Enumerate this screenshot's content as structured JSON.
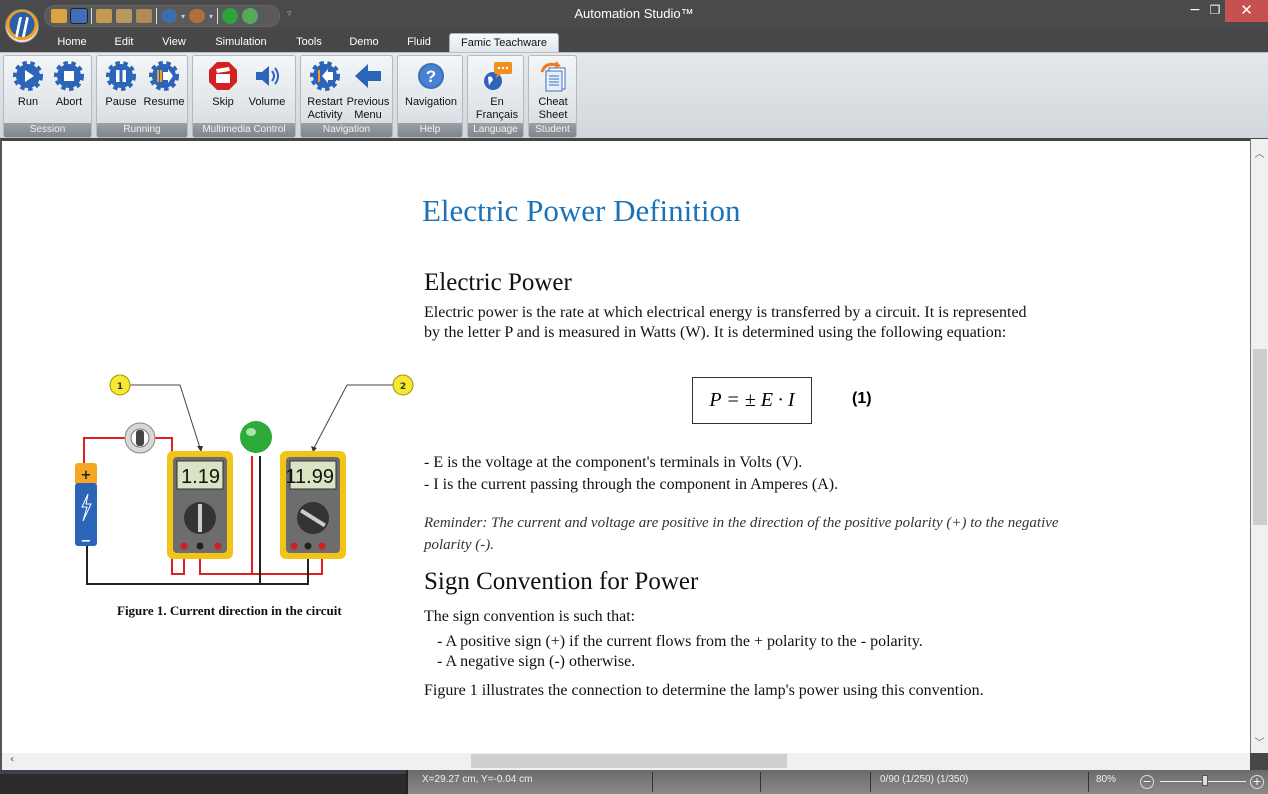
{
  "window": {
    "title": "Automation Studio™"
  },
  "quick_access": {
    "icons": [
      "open-project-icon",
      "project-settings-icon",
      "save-icon",
      "save-all-icon",
      "close-document-icon",
      "undo-icon",
      "redo-icon",
      "run-simulation-icon",
      "stop-simulation-icon"
    ]
  },
  "menu": {
    "tabs": [
      {
        "label": "Home"
      },
      {
        "label": "Edit"
      },
      {
        "label": "View"
      },
      {
        "label": "Simulation"
      },
      {
        "label": "Tools"
      },
      {
        "label": "Demo"
      },
      {
        "label": "Fluid"
      },
      {
        "label": "Famic Teachware",
        "active": true
      }
    ]
  },
  "ribbon": {
    "groups": [
      {
        "label": "Session",
        "buttons": [
          {
            "label": "Run",
            "icon": "gear-play-icon"
          },
          {
            "label": "Abort",
            "icon": "gear-stop-icon"
          }
        ]
      },
      {
        "label": "Running",
        "buttons": [
          {
            "label": "Pause",
            "icon": "gear-pause-icon"
          },
          {
            "label": "Resume",
            "icon": "gear-resume-icon"
          }
        ]
      },
      {
        "label": "Multimedia Control",
        "buttons": [
          {
            "label": "Skip",
            "icon": "clapperboard-icon"
          },
          {
            "label": "Volume",
            "icon": "speaker-icon"
          }
        ]
      },
      {
        "label": "Navigation",
        "buttons": [
          {
            "label1": "Restart",
            "label2": "Activity",
            "icon": "gear-restart-icon"
          },
          {
            "label1": "Previous",
            "label2": "Menu",
            "icon": "back-arrow-icon"
          }
        ]
      },
      {
        "label": "Help",
        "buttons": [
          {
            "label": "Navigation",
            "icon": "help-icon"
          }
        ]
      },
      {
        "label": "Language",
        "buttons": [
          {
            "label1": "En",
            "label2": "Français",
            "icon": "globe-chat-icon"
          }
        ]
      },
      {
        "label": "Student",
        "buttons": [
          {
            "label1": "Cheat",
            "label2": "Sheet",
            "icon": "cheat-sheet-icon"
          }
        ]
      }
    ]
  },
  "document": {
    "title": "Electric Power Definition",
    "section1": {
      "heading": "Electric Power",
      "para_line1": "Electric power is the rate at which electrical energy is transferred by a circuit. It is represented",
      "para_line2": "by the letter P and is measured in Watts (W). It is determined using the following equation:",
      "equation": "P = ± E · I",
      "equation_number": "(1)",
      "def_e": "- E is the voltage at the component's terminals in Volts (V).",
      "def_i": "- I is the current passing through the component in Amperes (A).",
      "reminder_line1": "Reminder: The current and voltage are positive in the direction of the positive polarity (+) to the negative",
      "reminder_line2": "polarity (-)."
    },
    "section2": {
      "heading": "Sign Convention for Power",
      "intro": "The sign convention is such that:",
      "bullet1": "- A positive sign (+) if the current flows from the + polarity to the - polarity.",
      "bullet2": "- A negative sign (-) otherwise.",
      "closing": "Figure 1 illustrates the connection to determine the lamp's power using this convention."
    },
    "figure": {
      "caption": "Figure 1. Current direction in the circuit",
      "callout1": "1",
      "callout2": "2",
      "meter1_reading": "1.19",
      "meter2_reading": "11.99",
      "battery_plus": "+",
      "battery_minus": "−"
    }
  },
  "statusbar": {
    "coords": "X=29.27 cm, Y=-0.04 cm",
    "counts": "0/90 (1/250) (1/350)",
    "zoom": "80%",
    "zoom_level_fraction": 0.52
  },
  "colors": {
    "accent_title": "#1a73b8",
    "close_red": "#c75050",
    "wire_red": "#e02020"
  }
}
